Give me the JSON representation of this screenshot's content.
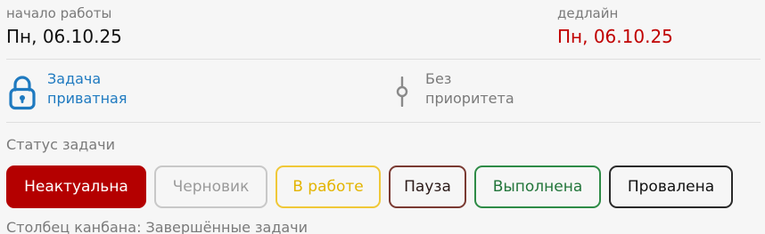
{
  "dates": {
    "start_label": "начало работы",
    "start_value": "Пн, 06.10.25",
    "deadline_label": "дедлайн",
    "deadline_value": "Пн, 06.10.25",
    "deadline_color": "#c00000"
  },
  "privacy": {
    "icon": "lock-icon",
    "line1": "Задача",
    "line2": "приватная",
    "color": "#1f7ac0"
  },
  "priority": {
    "icon": "priority-slider-icon",
    "line1": "Без",
    "line2": "приоритета"
  },
  "status": {
    "title": "Статус задачи",
    "options": [
      {
        "label": "Неактуальна",
        "selected": true,
        "color": "#b40000"
      },
      {
        "label": "Черновик",
        "selected": false,
        "color": "#9a9a9a"
      },
      {
        "label": "В работе",
        "selected": false,
        "color": "#e3b400"
      },
      {
        "label": "Пауза",
        "selected": false,
        "color": "#7a3a32"
      },
      {
        "label": "Выполнена",
        "selected": false,
        "color": "#2e8b46"
      },
      {
        "label": "Провалена",
        "selected": false,
        "color": "#2a2a2a"
      }
    ]
  },
  "kanban": {
    "text": "Столбец канбана: Завершённые задачи"
  }
}
